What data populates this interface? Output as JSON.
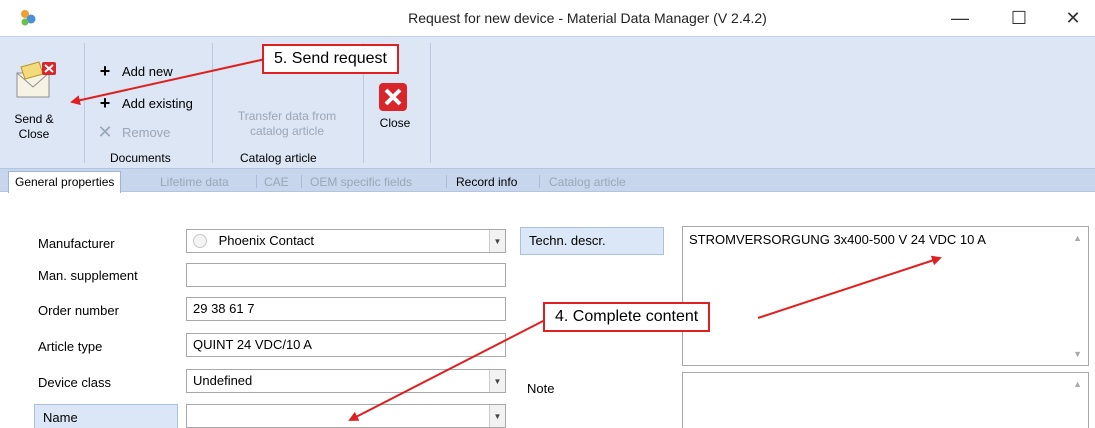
{
  "window": {
    "title": "Request for new device - Material Data Manager (V 2.4.2)",
    "minimize": "—",
    "maximize": "☐",
    "close": "✕"
  },
  "ribbon": {
    "send_close": "Send &\nClose",
    "documents": {
      "add_new": "Add new",
      "add_existing": "Add existing",
      "remove": "Remove",
      "group_label": "Documents"
    },
    "catalog": {
      "transfer": "Transfer data from\ncatalog article",
      "group_label": "Catalog article"
    },
    "close": "Close"
  },
  "tabs": [
    {
      "label": "General properties",
      "state": "active"
    },
    {
      "label": "Lifetime data",
      "state": "disabled"
    },
    {
      "label": "CAE",
      "state": "disabled"
    },
    {
      "label": "OEM specific fields",
      "state": "disabled"
    },
    {
      "label": "Record info",
      "state": "enabled"
    },
    {
      "label": "Catalog article",
      "state": "disabled"
    }
  ],
  "form": {
    "manufacturer": {
      "label": "Manufacturer",
      "value": "Phoenix Contact"
    },
    "man_supplement": {
      "label": "Man. supplement",
      "value": ""
    },
    "order_number": {
      "label": "Order number",
      "value": "29 38 61 7"
    },
    "article_type": {
      "label": "Article type",
      "value": "QUINT 24 VDC/10 A"
    },
    "device_class": {
      "label": "Device class",
      "value": "Undefined"
    },
    "name": {
      "label": "Name",
      "value": ""
    },
    "techn_descr": {
      "label": "Techn. descr.",
      "value": "STROMVERSORGUNG 3x400-500 V 24 VDC 10 A"
    },
    "note": {
      "label": "Note",
      "value": ""
    }
  },
  "annotations": {
    "send_request": "5. Send request",
    "complete_content": "4. Complete content"
  },
  "colors": {
    "ribbon_bg": "#dce6f4",
    "annotation": "#e02020",
    "close_button": "#d9262b"
  }
}
